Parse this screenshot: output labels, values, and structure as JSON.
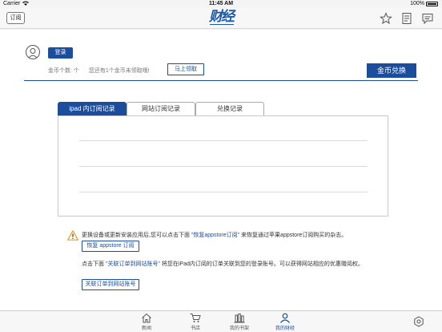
{
  "status_bar": {
    "carrier": "Carrier",
    "time": "11:45 AM",
    "battery": "100%"
  },
  "nav": {
    "subscribe_label": "订阅",
    "logo_text": "财经",
    "icons": [
      "star-icon",
      "document-icon",
      "comment-icon"
    ]
  },
  "account": {
    "login_label": "登录",
    "coin_count_text": "金币个数: 个",
    "coin_tip_text": "您还有1个金币未领取哦!",
    "get_now_label": "马上领取",
    "exchange_label": "金币兑换"
  },
  "tabs": [
    {
      "label": "ipad 内订阅记录",
      "active": true
    },
    {
      "label": "网站订阅记录",
      "active": false
    },
    {
      "label": "兑换记录",
      "active": false
    }
  ],
  "notice": {
    "restore_pre": "更换设备或更新安装应用后,您可以点击下面 ",
    "restore_hl": "\"恢复appstore订阅\"",
    "restore_post": " 来恢复通过苹果appstore订阅购买的杂志。",
    "restore_button": "恢复 appstore 订阅",
    "link_pre": "点击下面 ",
    "link_hl": "\"关联订单到网站账号\"",
    "link_post": " 将您在iPad内订阅的订单关联到您的登录账号。可以获得网站相应的优惠赠阅权。",
    "link_button": "关联订单到网站账号"
  },
  "tab_bar": {
    "items": [
      {
        "label": "新闻",
        "icon": "home-icon",
        "active": false
      },
      {
        "label": "书店",
        "icon": "cart-icon",
        "active": false
      },
      {
        "label": "我的书架",
        "icon": "bookshelf-icon",
        "active": false
      },
      {
        "label": "我的财经",
        "icon": "person-icon",
        "active": true
      }
    ],
    "settings_icon": "settings-icon"
  },
  "colors": {
    "accent": "#1b4d9c",
    "logo": "#1b5aa8"
  }
}
